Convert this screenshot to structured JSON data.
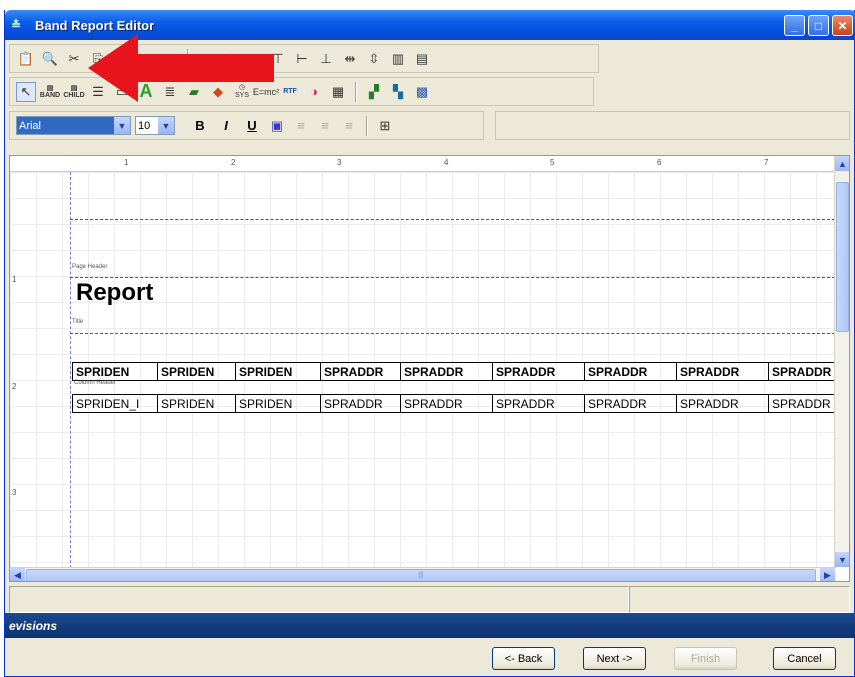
{
  "window": {
    "title": "Band Report Editor"
  },
  "toolbar": {
    "font_name": "Arial",
    "font_size": "10",
    "bold": "B",
    "italic": "I",
    "underline": "U",
    "band_label": "BAND",
    "child_label": "CHILD",
    "eq_label": "E=mc²",
    "sys_label": "SYS",
    "rtf_label": "RTF"
  },
  "ruler": {
    "h": [
      "1",
      "2",
      "3",
      "4",
      "5",
      "6",
      "7"
    ],
    "v": [
      "1",
      "2",
      "3"
    ]
  },
  "designer": {
    "page_header_label": "Page Header",
    "title_label": "Title",
    "report_title": "Report",
    "column_header_label": "Column Header",
    "header_cells": [
      "SPRIDEN",
      "SPRIDEN",
      "SPRIDEN",
      "SPRADDR",
      "SPRADDR",
      "SPRADDR",
      "SPRADDR",
      "SPRADDR",
      "SPRADDR"
    ],
    "detail_cells": [
      "SPRIDEN_I",
      "SPRIDEN",
      "SPRIDEN",
      "SPRADDR",
      "SPRADDR",
      "SPRADDR",
      "SPRADDR",
      "SPRADDR",
      "SPRADDR"
    ]
  },
  "brand": "evisions",
  "buttons": {
    "back": "<- Back",
    "next": "Next ->",
    "finish": "Finish",
    "cancel": "Cancel"
  },
  "annotation": {
    "arrow_color": "#e8141c"
  }
}
